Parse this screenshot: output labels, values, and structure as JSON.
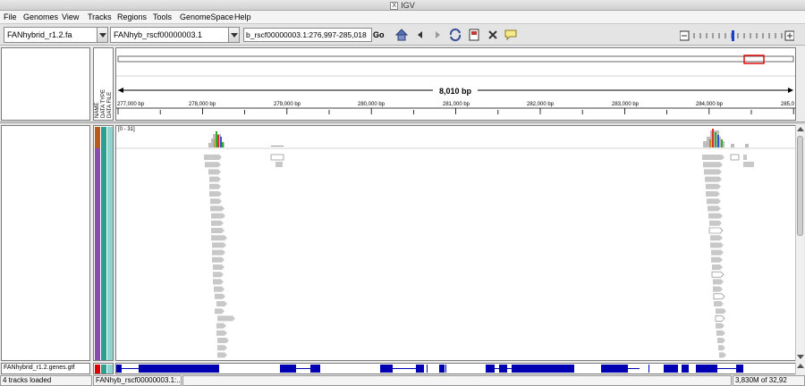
{
  "window": {
    "title": "IGV"
  },
  "menu": [
    "File",
    "Genomes",
    "View",
    "Tracks",
    "Regions",
    "Tools",
    "GenomeSpace",
    "Help"
  ],
  "toolbar": {
    "genome": "FANhybrid_r1.2.fa",
    "chromosome": "FANhyb_rscf00000003.1",
    "locus": "b_rscf00000003.1:276,997-285,018",
    "go_label": "Go",
    "icons": [
      "home-icon",
      "back-icon",
      "forward-icon",
      "refresh-icon",
      "roi-icon",
      "close-icon",
      "popup-text-icon"
    ]
  },
  "header": {
    "column_labels": [
      "NAME",
      "DATA TYPE",
      "DATA FILE"
    ],
    "span_label": "8,010 bp",
    "ruler_ticks": [
      "277,000 bp",
      "278,000 bp",
      "279,000 bp",
      "280,000 bp",
      "281,000 bp",
      "282,000 bp",
      "283,000 bp",
      "284,000 bp",
      "285,0"
    ]
  },
  "data_panel": {
    "coverage_range": "[0 - 31]"
  },
  "feature_panel": {
    "track_name": "FANhybrid_r1.2.genes.gtf"
  },
  "colors": {
    "coverage_bar": "#bdbdbd",
    "read_fill": "#c8c8c8",
    "gene_feature": "#0000b2",
    "roi_box": "#e00000",
    "attr_col1": "#b85c1d",
    "attr_col2": "#8a4bb0",
    "attr_col3": "#2ba08f"
  },
  "status": {
    "tracks_loaded": "4 tracks loaded",
    "locus_short": "FANhyb_rscf00000003.1:...",
    "memory": "3,830M of 32,92"
  }
}
